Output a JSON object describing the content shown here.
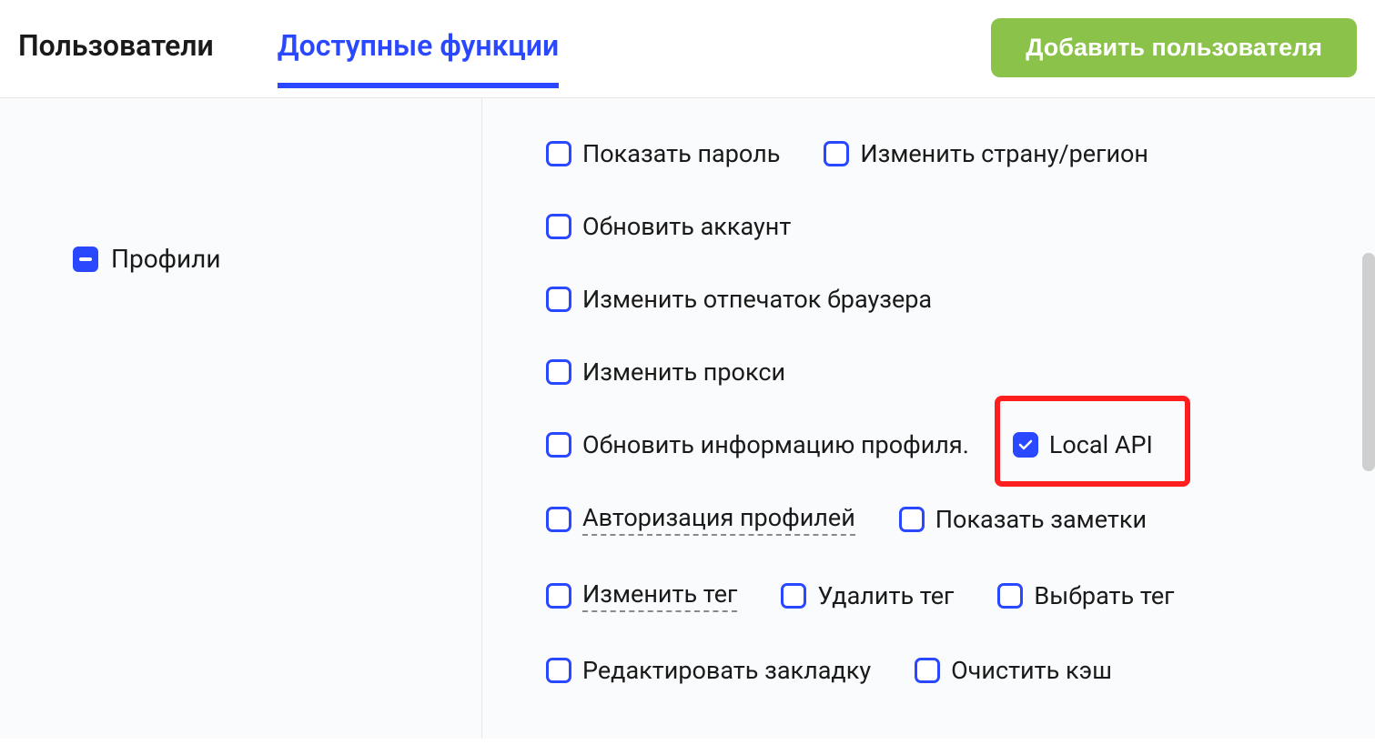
{
  "tabs": {
    "users": "Пользователи",
    "functions": "Доступные функции"
  },
  "addButton": "Добавить пользователя",
  "sidebar": {
    "category": "Профили"
  },
  "checkboxes": {
    "showPassword": "Показать пароль",
    "changeCountry": "Изменить страну/регион",
    "updateAccount": "Обновить аккаунт",
    "changeFingerprint": "Изменить отпечаток браузера",
    "changeProxy": "Изменить прокси",
    "updateProfileInfo": "Обновить информацию профиля.",
    "localApi": "Local API",
    "authProfiles": "Авторизация профилей",
    "showNotes": "Показать заметки",
    "changeTag": "Изменить тег",
    "deleteTag": "Удалить тег",
    "selectTag": "Выбрать тег",
    "editBookmark": "Редактировать закладку",
    "clearCache": "Очистить кэш"
  }
}
